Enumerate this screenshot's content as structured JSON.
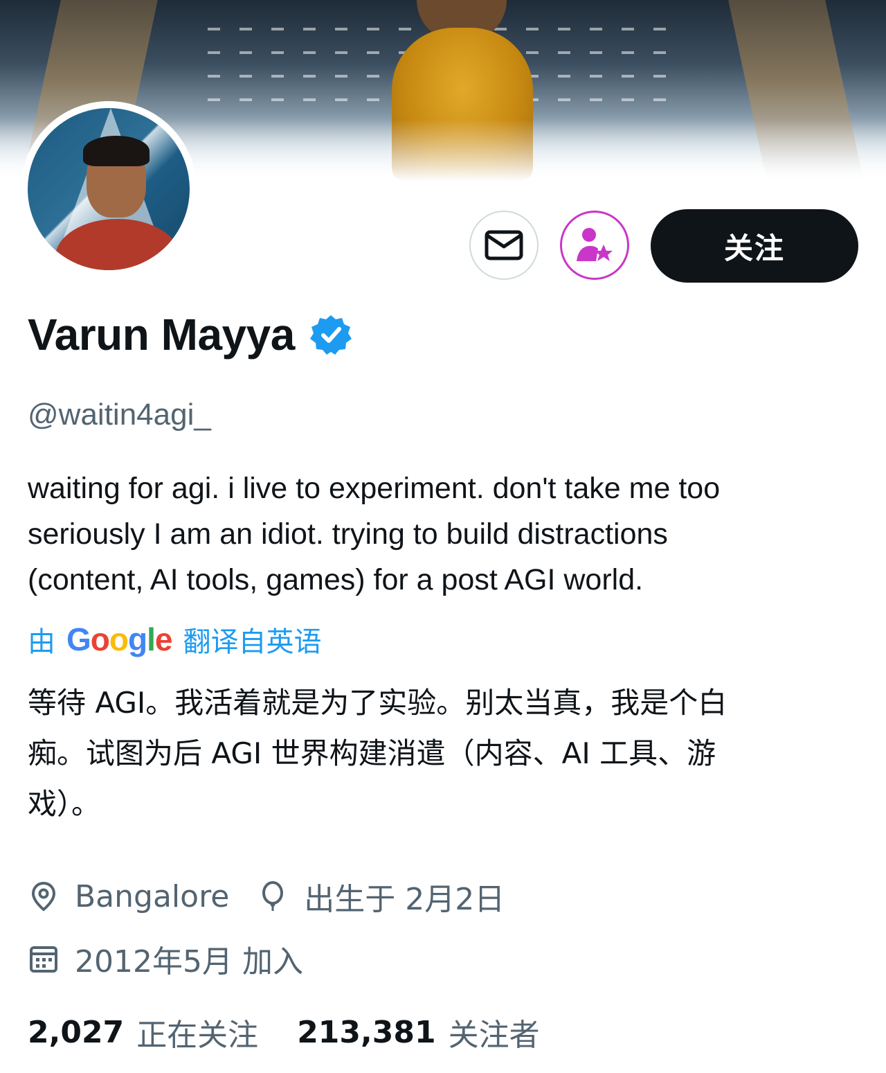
{
  "profile": {
    "name": "Varun Mayya",
    "handle": "@waitin4agi_",
    "bio": "waiting for agi. i live to experiment. don't take me too\nseriously I am an idiot. trying to build distractions\n(content, AI tools, games) for a post AGI world.",
    "translation": {
      "prefix": "由",
      "brand": "Google",
      "suffix": "翻译自英语"
    },
    "bio_translated": "等待 AGI。我活着就是为了实验。别太当真，我是个白\n痴。试图为后 AGI 世界构建消遣（内容、AI 工具、游\n戏）。",
    "location": "Bangalore",
    "birthday": "出生于 2月2日",
    "joined": "2012年5月 加入",
    "following_count": "2,027",
    "following_label": "正在关注",
    "followers_count": "213,381",
    "followers_label": "关注者"
  },
  "actions": {
    "follow_label": "关注"
  },
  "icons": {
    "message": "envelope-icon",
    "subscribe": "person-star-icon",
    "verified": "verified-badge-icon",
    "location": "location-pin-icon",
    "birthday": "balloon-icon",
    "joined": "calendar-icon"
  },
  "colors": {
    "accent": "#1d9bf0",
    "subscribe": "#c936c9",
    "text_primary": "#0f1419",
    "text_secondary": "#536471",
    "follow_bg": "#0f1419"
  }
}
